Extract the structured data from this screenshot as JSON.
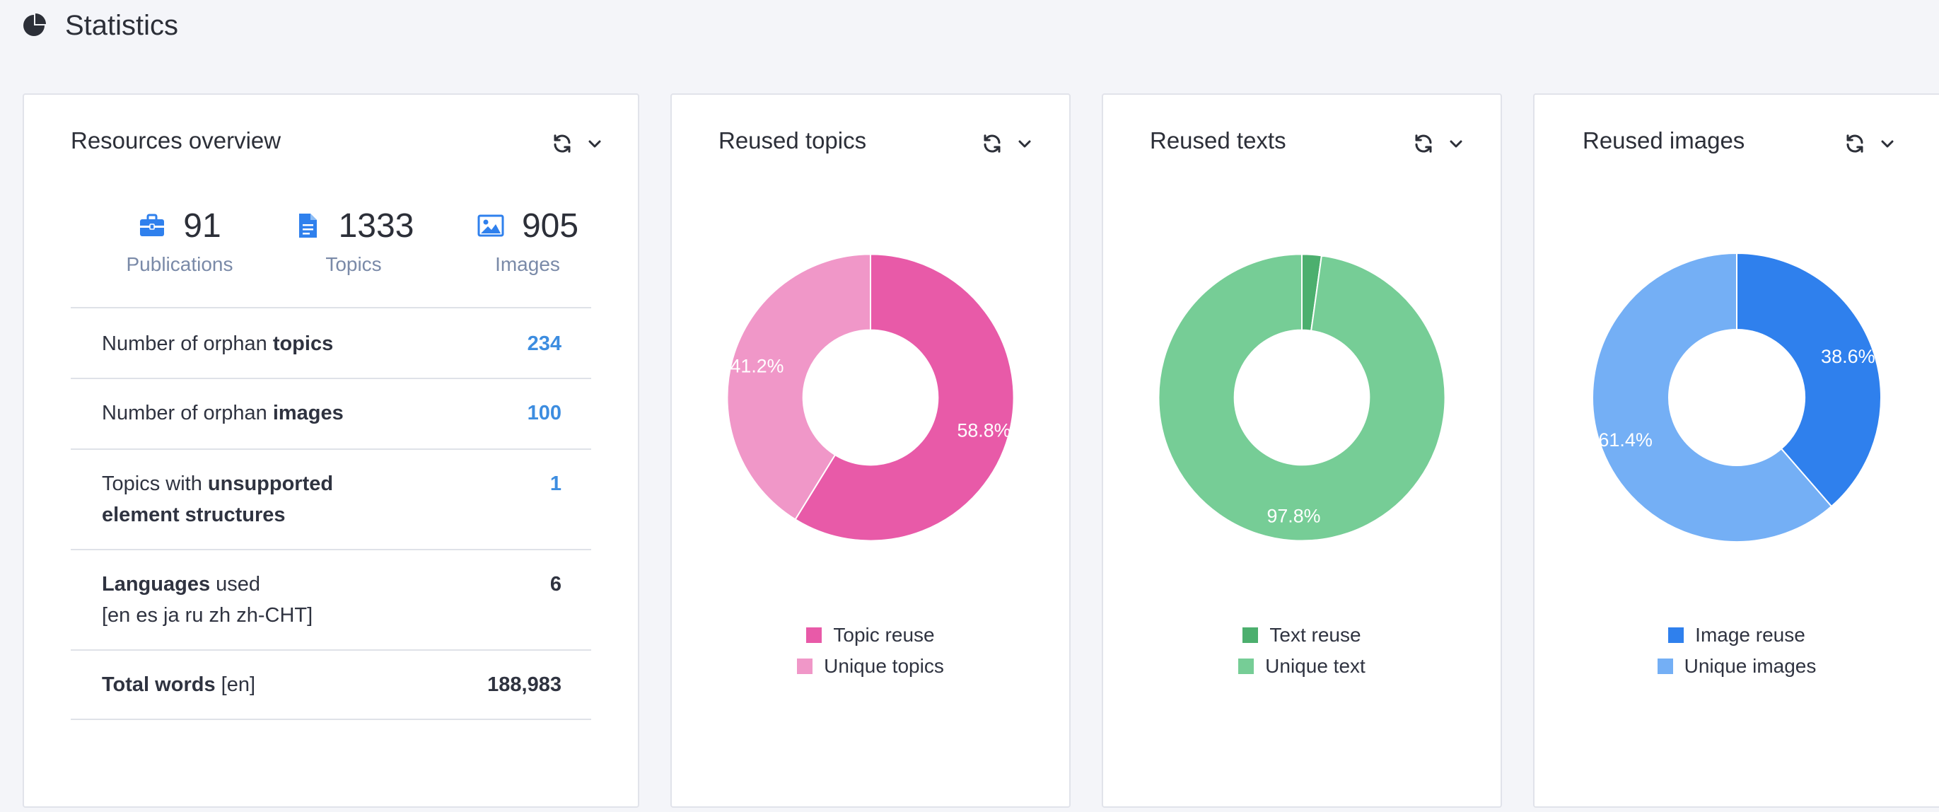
{
  "page": {
    "title": "Statistics",
    "icon": "pie-chart-icon"
  },
  "overview": {
    "title": "Resources overview",
    "stats": [
      {
        "icon": "briefcase-icon",
        "value": "91",
        "label": "Publications"
      },
      {
        "icon": "document-icon",
        "value": "1333",
        "label": "Topics"
      },
      {
        "icon": "image-icon",
        "value": "905",
        "label": "Images"
      }
    ],
    "rows": [
      {
        "prefix": "Number of orphan ",
        "bold": "topics",
        "suffix": "",
        "line2_bold": "",
        "line2": "",
        "value": "234",
        "value_style": "link"
      },
      {
        "prefix": "Number of orphan ",
        "bold": "images",
        "suffix": "",
        "line2_bold": "",
        "line2": "",
        "value": "100",
        "value_style": "link"
      },
      {
        "prefix": "Topics with ",
        "bold": "unsupported",
        "suffix": "",
        "line2_bold": "element structures",
        "line2": "",
        "value": "1",
        "value_style": "link"
      },
      {
        "prefix": "",
        "bold": "Languages",
        "suffix": " used",
        "line2_bold": "",
        "line2": "[en es ja ru zh zh-CHT]",
        "value": "6",
        "value_style": "dark"
      },
      {
        "prefix": "",
        "bold": "Total words",
        "suffix": " [en]",
        "line2_bold": "",
        "line2": "",
        "value": "188,983",
        "value_style": "dark"
      }
    ]
  },
  "charts": {
    "topics": {
      "title": "Reused topics",
      "series": [
        {
          "name": "Topic reuse",
          "value": 58.8,
          "label": "58.8%",
          "color": "#e85aa8"
        },
        {
          "name": "Unique topics",
          "value": 41.2,
          "label": "41.2%",
          "color": "#f097c8"
        }
      ]
    },
    "texts": {
      "title": "Reused texts",
      "series": [
        {
          "name": "Text reuse",
          "value": 2.2,
          "label": "",
          "color": "#4caf6e"
        },
        {
          "name": "Unique text",
          "value": 97.8,
          "label": "97.8%",
          "color": "#76cd96"
        }
      ]
    },
    "images": {
      "title": "Reused images",
      "series": [
        {
          "name": "Image reuse",
          "value": 38.6,
          "label": "38.6%",
          "color": "#2f80ed"
        },
        {
          "name": "Unique images",
          "value": 61.4,
          "label": "61.4%",
          "color": "#74aff5"
        }
      ]
    }
  },
  "chart_data": [
    {
      "type": "pie",
      "title": "Reused topics",
      "categories": [
        "Topic reuse",
        "Unique topics"
      ],
      "values": [
        58.8,
        41.2
      ],
      "legend": "bottom"
    },
    {
      "type": "pie",
      "title": "Reused texts",
      "categories": [
        "Text reuse",
        "Unique text"
      ],
      "values": [
        2.2,
        97.8
      ],
      "legend": "bottom"
    },
    {
      "type": "pie",
      "title": "Reused images",
      "categories": [
        "Image reuse",
        "Unique images"
      ],
      "values": [
        38.6,
        61.4
      ],
      "legend": "bottom"
    }
  ],
  "icons": {
    "refresh": "refresh-icon",
    "chevron": "chevron-down-icon"
  },
  "colors": {
    "accent": "#2f80ed",
    "link": "#3d8de0",
    "muted_label": "#7a8aa8"
  }
}
